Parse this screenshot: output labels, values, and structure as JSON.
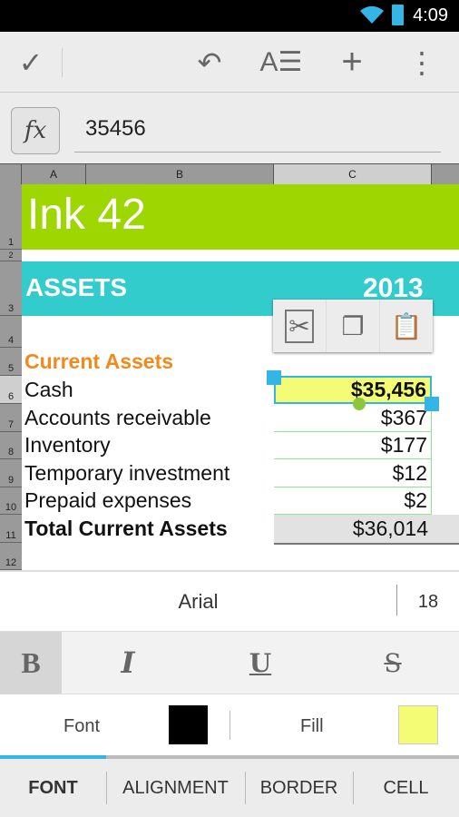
{
  "status_bar": {
    "time": "4:09"
  },
  "toolbar": {
    "confirm_icon": "check-icon",
    "undo_icon": "undo-icon",
    "format_icon": "text-format-icon",
    "add_icon": "plus-icon",
    "menu_icon": "overflow-menu-icon"
  },
  "formula_bar": {
    "fx_label": "fx",
    "value": "35456"
  },
  "columns": [
    "A",
    "B",
    "C"
  ],
  "rows": [
    "1",
    "2",
    "3",
    "4",
    "5",
    "6",
    "7",
    "8",
    "9",
    "10",
    "11",
    "12"
  ],
  "sheet": {
    "title": "Ink 42",
    "section": "ASSETS",
    "year": "2013",
    "subheading": "Current Assets",
    "items": [
      {
        "label": "Cash",
        "value": "$35,456"
      },
      {
        "label": "Accounts receivable",
        "value": "$367"
      },
      {
        "label": "Inventory",
        "value": "$177"
      },
      {
        "label": "Temporary investment",
        "value": "$12"
      },
      {
        "label": "Prepaid expenses",
        "value": "$2"
      }
    ],
    "total": {
      "label": "Total Current Assets",
      "value": "$36,014"
    }
  },
  "colors": {
    "title_bg": "#9dd600",
    "section_bg": "#33cccc",
    "subheading": "#f08a1c",
    "selected_fill": "#f4fb74",
    "accent": "#33b5e5"
  },
  "format_panel": {
    "font_name": "Arial",
    "font_size": "18",
    "bold": "B",
    "italic": "I",
    "underline": "U",
    "strikethrough": "S",
    "font_color_label": "Font",
    "font_color": "#000000",
    "fill_color_label": "Fill",
    "fill_color": "#f4fb74"
  },
  "tabs": [
    {
      "label": "FONT",
      "selected": true
    },
    {
      "label": "ALIGNMENT"
    },
    {
      "label": "BORDER"
    },
    {
      "label": "CELL"
    }
  ]
}
